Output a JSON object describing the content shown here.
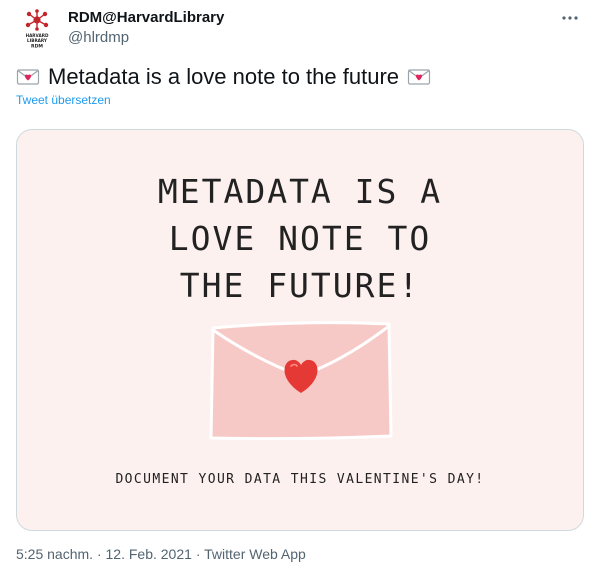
{
  "author": {
    "name": "RDM@HarvardLibrary",
    "handle": "@hlrdmp",
    "avatar_icon": "rdm-network-logo",
    "avatar_text_lines": [
      "HARVARD",
      "LIBRARY",
      "RDM"
    ]
  },
  "tweet": {
    "text": "Metadata is a love note to the future",
    "emoji_icon": "love-letter-emoji",
    "translate_label": "Tweet übersetzen",
    "more_icon": "more-dots-icon"
  },
  "media": {
    "headline": "METADATA IS A\nLOVE NOTE TO\nTHE FUTURE!",
    "subline": "DOCUMENT YOUR DATA THIS VALENTINE'S DAY!",
    "background_color": "#fdf1ef",
    "envelope_color": "#f7c9c6",
    "heart_color": "#e53935"
  },
  "footer": {
    "time": "5:25 nachm.",
    "separator": "·",
    "date": "12. Feb. 2021",
    "source": "Twitter Web App"
  }
}
